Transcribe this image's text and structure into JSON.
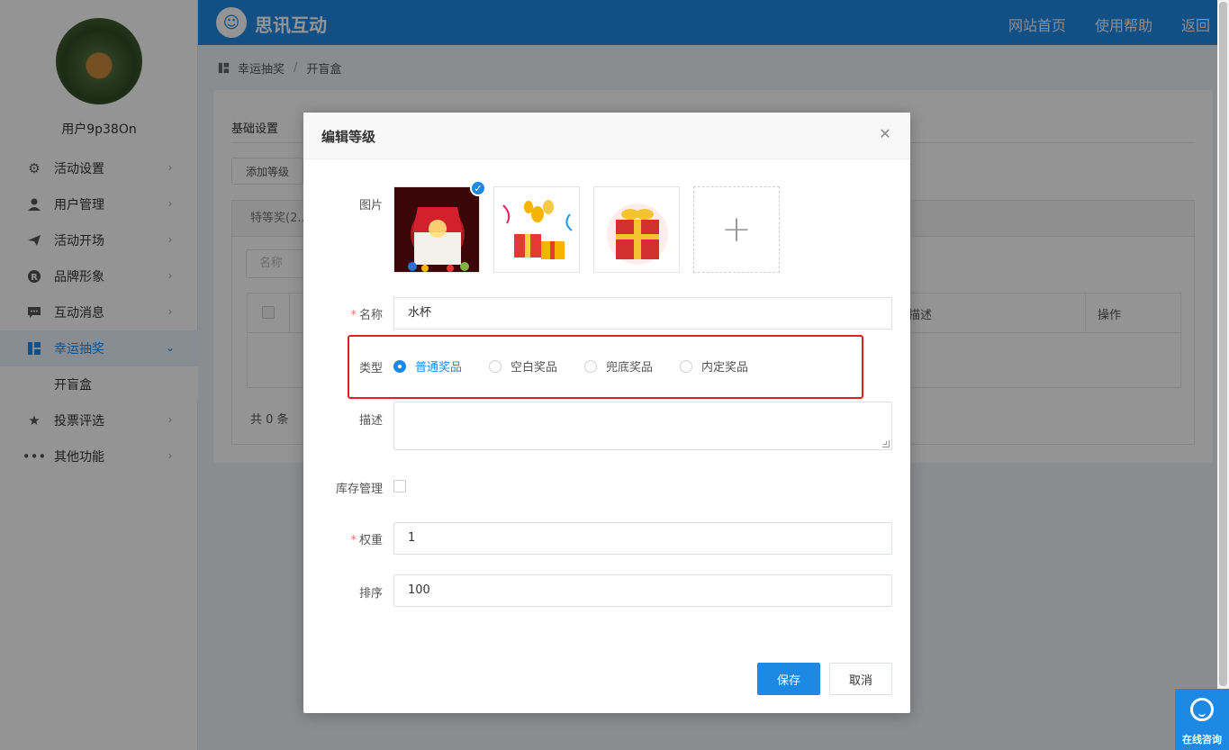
{
  "sidebar": {
    "username": "用户9p38On",
    "items": [
      {
        "label": "活动设置",
        "icon": "gear-icon"
      },
      {
        "label": "用户管理",
        "icon": "user-icon"
      },
      {
        "label": "活动开场",
        "icon": "paper-plane-icon"
      },
      {
        "label": "品牌形象",
        "icon": "registered-icon"
      },
      {
        "label": "互动消息",
        "icon": "message-icon"
      },
      {
        "label": "幸运抽奖",
        "icon": "dashboard-icon"
      },
      {
        "label": "开盲盒",
        "icon": ""
      },
      {
        "label": "投票评选",
        "icon": "star-icon"
      },
      {
        "label": "其他功能",
        "icon": "more-icon"
      }
    ]
  },
  "header": {
    "brand": "思讯互动",
    "links": [
      "网站首页",
      "使用帮助",
      "返回"
    ]
  },
  "breadcrumb": {
    "items": [
      "幸运抽奖",
      "开盲盒"
    ],
    "separator": "/"
  },
  "background": {
    "tab": "基础设置",
    "add_button": "添加等级",
    "panel_title": "特等奖(2...",
    "filter_placeholder": "名称",
    "table_headers": [
      "描述",
      "操作"
    ],
    "total": "共 0 条"
  },
  "dialog": {
    "title": "编辑等级",
    "image_label": "图片",
    "name_label": "名称",
    "name_value": "水杯",
    "type_label": "类型",
    "type_options": [
      "普通奖品",
      "空白奖品",
      "兜底奖品",
      "内定奖品"
    ],
    "type_selected": "普通奖品",
    "desc_label": "描述",
    "desc_value": "",
    "stock_label": "库存管理",
    "weight_label": "权重",
    "weight_value": "1",
    "order_label": "排序",
    "order_value": "100",
    "save_label": "保存",
    "cancel_label": "取消"
  },
  "consult": {
    "label": "在线咨询"
  },
  "colors": {
    "primary": "#1e88e5",
    "highlight": "#e02020",
    "required": "#f56c6c"
  }
}
